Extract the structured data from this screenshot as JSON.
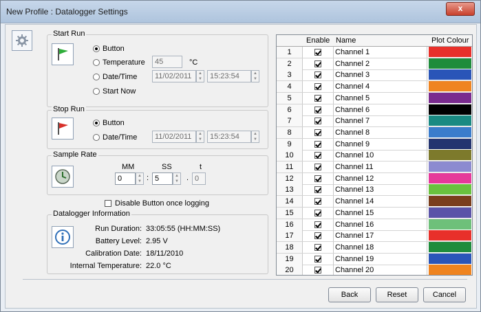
{
  "window": {
    "title": "New Profile : Datalogger Settings",
    "close_label": "x"
  },
  "start_run": {
    "legend": "Start Run",
    "options": {
      "button": "Button",
      "temperature": "Temperature",
      "datetime": "Date/Time",
      "start_now": "Start Now"
    },
    "selected": "button",
    "temperature_value": "45",
    "temperature_unit": "°C",
    "date_value": "11/02/2011",
    "time_value": "15:23:54"
  },
  "stop_run": {
    "legend": "Stop Run",
    "options": {
      "button": "Button",
      "datetime": "Date/Time"
    },
    "selected": "button",
    "date_value": "11/02/2011",
    "time_value": "15:23:54"
  },
  "sample_rate": {
    "legend": "Sample Rate",
    "headers": {
      "mm": "MM",
      "ss": "SS",
      "t": "t"
    },
    "values": {
      "mm": "0",
      "ss": "5",
      "t": "0"
    },
    "sep_colon": ":",
    "sep_dot": "."
  },
  "disable_button": {
    "label": "Disable Button once logging",
    "checked": false
  },
  "datalogger_info": {
    "legend": "Datalogger Information",
    "rows": [
      {
        "label": "Run Duration:",
        "value": "33:05:55 (HH:MM:SS)"
      },
      {
        "label": "Battery Level:",
        "value": "2.95 V"
      },
      {
        "label": "Calibration Date:",
        "value": "18/11/2010"
      },
      {
        "label": "Internal Temperature:",
        "value": "22.0 °C"
      }
    ]
  },
  "channels": {
    "headers": {
      "enable": "Enable",
      "name": "Name",
      "colour": "Plot Colour"
    },
    "rows": [
      {
        "n": "1",
        "name": "Channel 1",
        "enabled": true,
        "color": "#e8302a"
      },
      {
        "n": "2",
        "name": "Channel 2",
        "enabled": true,
        "color": "#1f8c3c"
      },
      {
        "n": "3",
        "name": "Channel 3",
        "enabled": true,
        "color": "#2a55b8"
      },
      {
        "n": "4",
        "name": "Channel 4",
        "enabled": true,
        "color": "#ef8420"
      },
      {
        "n": "5",
        "name": "Channel 5",
        "enabled": true,
        "color": "#7a2a8e"
      },
      {
        "n": "6",
        "name": "Channel 6",
        "enabled": true,
        "color": "#000000"
      },
      {
        "n": "7",
        "name": "Channel 7",
        "enabled": true,
        "color": "#1a8a82"
      },
      {
        "n": "8",
        "name": "Channel 8",
        "enabled": true,
        "color": "#3a7ccc"
      },
      {
        "n": "9",
        "name": "Channel 9",
        "enabled": true,
        "color": "#243470"
      },
      {
        "n": "10",
        "name": "Channel 10",
        "enabled": true,
        "color": "#7d7a2c"
      },
      {
        "n": "11",
        "name": "Channel 11",
        "enabled": true,
        "color": "#8c8ad0"
      },
      {
        "n": "12",
        "name": "Channel 12",
        "enabled": true,
        "color": "#e6399a"
      },
      {
        "n": "13",
        "name": "Channel 13",
        "enabled": true,
        "color": "#69c23e"
      },
      {
        "n": "14",
        "name": "Channel 14",
        "enabled": true,
        "color": "#7a3e1c"
      },
      {
        "n": "15",
        "name": "Channel 15",
        "enabled": true,
        "color": "#5b53a8"
      },
      {
        "n": "16",
        "name": "Channel 16",
        "enabled": true,
        "color": "#6ec07a"
      },
      {
        "n": "17",
        "name": "Channel 17",
        "enabled": true,
        "color": "#e8302a"
      },
      {
        "n": "18",
        "name": "Channel 18",
        "enabled": true,
        "color": "#1f8c3c"
      },
      {
        "n": "19",
        "name": "Channel 19",
        "enabled": true,
        "color": "#2a55b8"
      },
      {
        "n": "20",
        "name": "Channel 20",
        "enabled": true,
        "color": "#ef8420"
      }
    ]
  },
  "buttons": {
    "back": "Back",
    "reset": "Reset",
    "cancel": "Cancel"
  }
}
